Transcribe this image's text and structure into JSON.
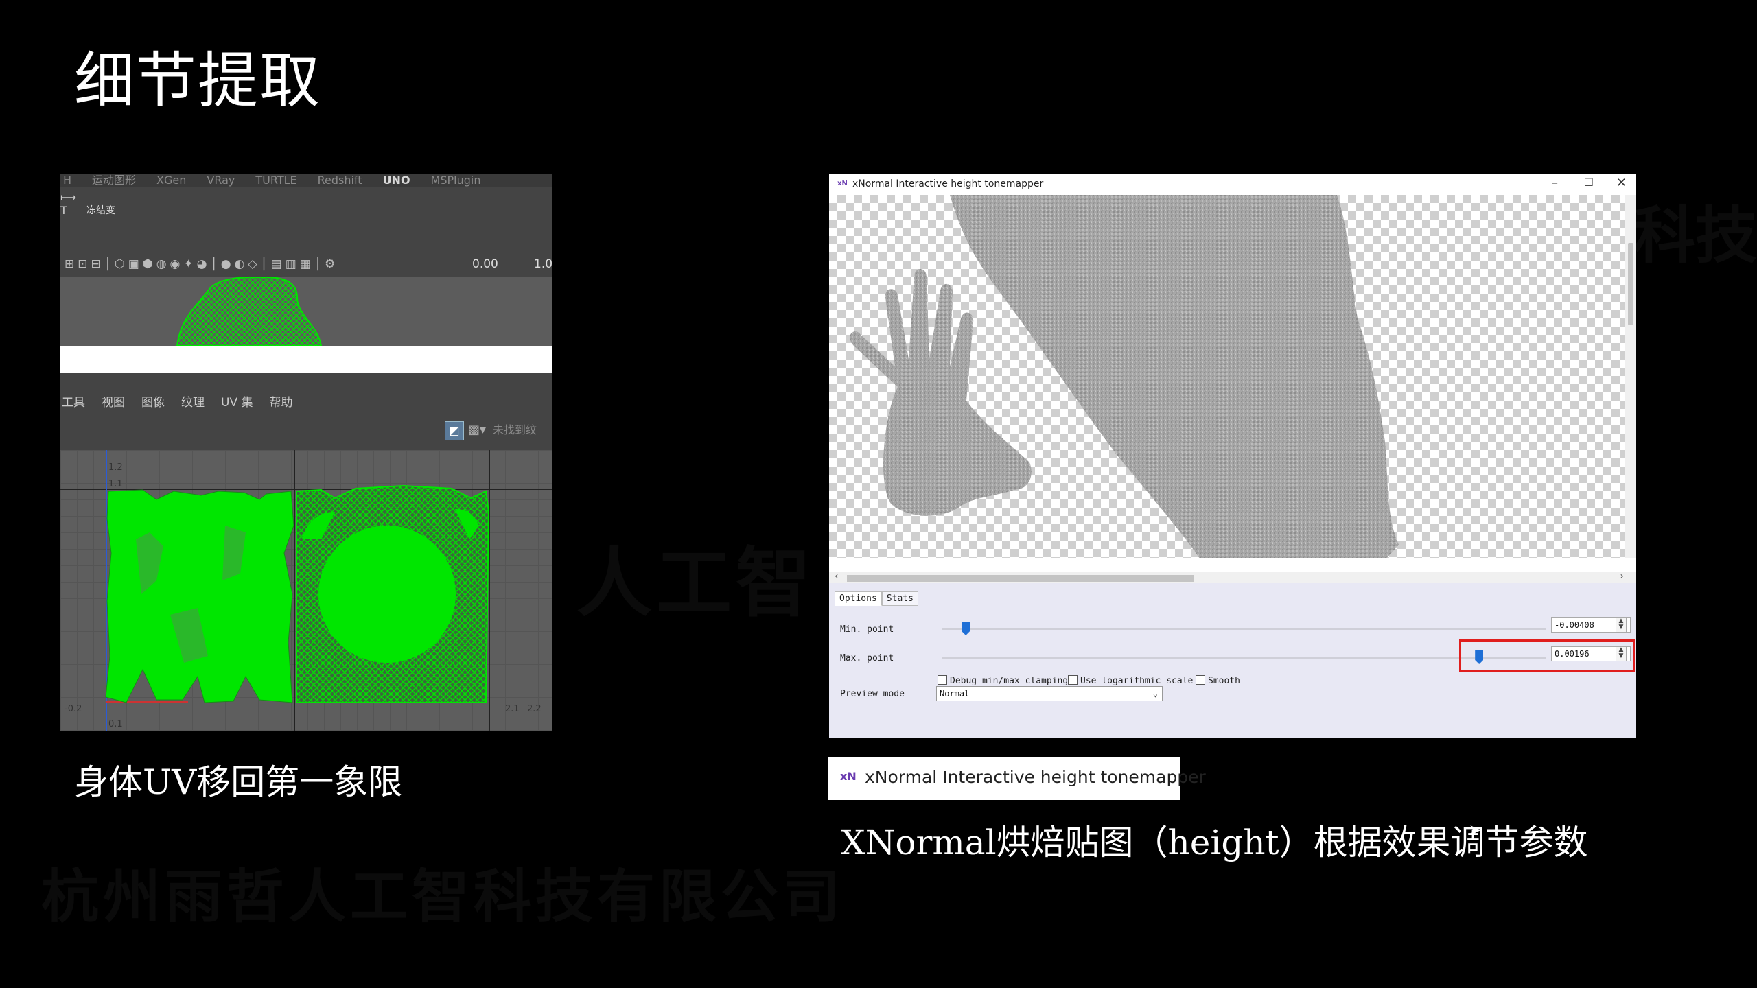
{
  "slide": {
    "title": "细节提取",
    "caption_left": "身体UV移回第一象限",
    "caption_right": "XNormal烘焙贴图（height）根据效果调节参数"
  },
  "maya": {
    "shelf_tabs": [
      "H",
      "运动图形",
      "XGen",
      "VRay",
      "TURTLE",
      "Redshift",
      "UNO",
      "MSPlugin"
    ],
    "active_shelf_tab": "UNO",
    "shelf_button_label": "冻结变",
    "toolbar_value_1": "0.00",
    "toolbar_value_2": "1.0",
    "uv_menu": [
      "工具",
      "视图",
      "图像",
      "纹理",
      "UV 集",
      "帮助"
    ],
    "uv_toolbar_text": "未找到纹",
    "uv_ticks": [
      "1.2",
      "1.1",
      "-0.2",
      "0.1",
      "2.1",
      "2.2"
    ]
  },
  "xnormal": {
    "window_logo": "xN",
    "window_title": "xNormal Interactive height tonemapper",
    "tabs": [
      "Options",
      "Stats"
    ],
    "min_label": "Min. point",
    "min_value": "-0.00408",
    "max_label": "Max. point",
    "max_value": "0.00196",
    "checkbox_debug": "Debug min/max clamping",
    "checkbox_log": "Use logarithmic scale",
    "checkbox_smooth": "Smooth",
    "preview_label": "Preview mode",
    "preview_value": "Normal",
    "min_slider_pos": 0.04,
    "max_slider_pos": 0.89
  },
  "zoom_crop": {
    "logo": "xN",
    "title": "xNormal Interactive height tonemapper"
  },
  "watermarks": [
    "杭州雨哲人工智科技有限公司",
    "人工智",
    "科技"
  ],
  "colors": {
    "background": "#000000",
    "uv_green": "#00e600",
    "slider_blue": "#1f6fd6",
    "highlight_red": "#e01e1e",
    "xn_panel": "#e8e8f4"
  }
}
